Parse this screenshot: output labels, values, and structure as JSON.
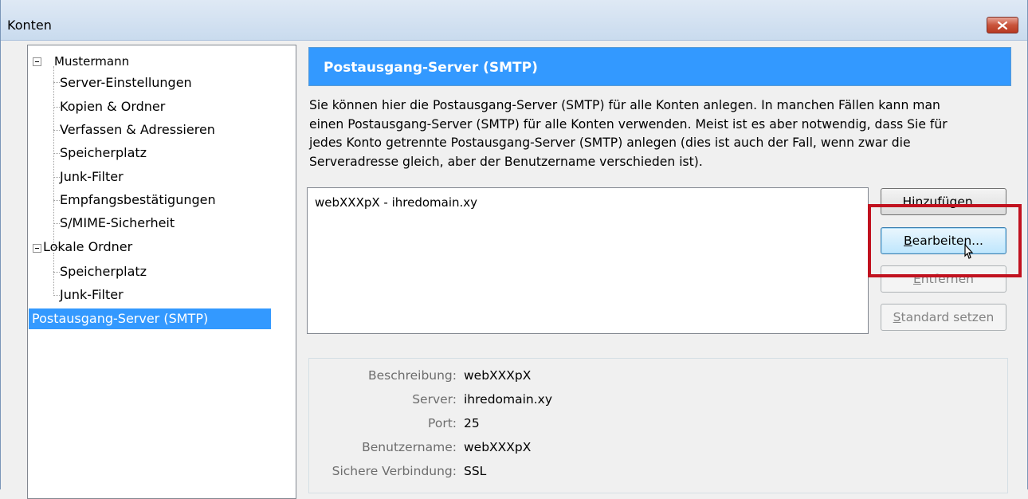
{
  "window": {
    "title": "Konten"
  },
  "tree": {
    "groups": [
      {
        "label": "Mustermann",
        "children": [
          "Server-Einstellungen",
          "Kopien & Ordner",
          "Verfassen & Adressieren",
          "Speicherplatz",
          "Junk-Filter",
          "Empfangsbestätigungen",
          "S/MIME-Sicherheit"
        ]
      },
      {
        "label": "Lokale Ordner",
        "children": [
          "Speicherplatz",
          "Junk-Filter"
        ]
      }
    ],
    "selected": "Postausgang-Server (SMTP)"
  },
  "panel": {
    "title": "Postausgang-Server (SMTP)",
    "description_lines": [
      "Sie können hier die Postausgang-Server (SMTP) für alle Konten anlegen. In manchen Fällen kann man",
      "einen Postausgang-Server (SMTP) für alle Konten verwenden. Meist ist es aber notwendig, dass Sie für",
      "jedes Konto getrennte Postausgang-Server (SMTP) anlegen (dies ist auch der Fall, wenn zwar die",
      "Serveradresse gleich, aber der Benutzername verschieden ist)."
    ],
    "server_list": [
      "webXXXpX - ihredomain.xy"
    ],
    "buttons": {
      "add": {
        "mnemonic": "H",
        "rest": "inzufügen..."
      },
      "edit": {
        "mnemonic": "B",
        "rest": "earbeiten..."
      },
      "remove": {
        "mnemonic": "E",
        "rest": "ntfernen"
      },
      "default": {
        "mnemonic": "S",
        "rest": "tandard setzen"
      }
    },
    "details": [
      {
        "label": "Beschreibung:",
        "value": "webXXXpX"
      },
      {
        "label": "Server:",
        "value": "ihredomain.xy"
      },
      {
        "label": "Port:",
        "value": "25"
      },
      {
        "label": "Benutzername:",
        "value": "webXXXpX"
      },
      {
        "label": "Sichere Verbindung:",
        "value": "SSL"
      }
    ]
  },
  "colors": {
    "accent": "#3399ff",
    "highlight": "#c1121f"
  }
}
